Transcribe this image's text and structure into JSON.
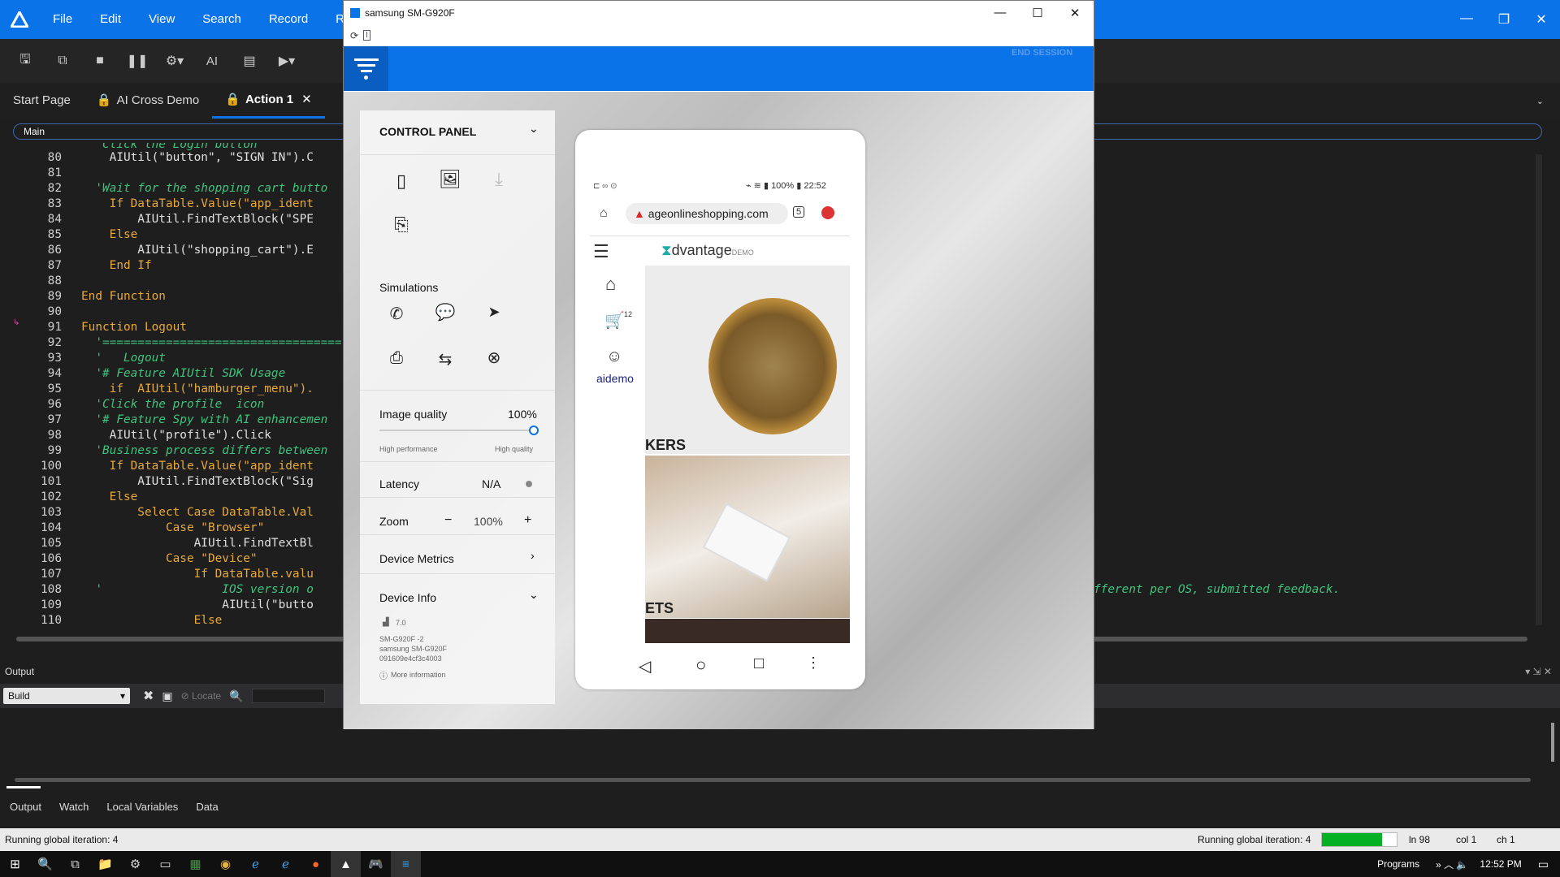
{
  "menu": {
    "items": [
      "File",
      "Edit",
      "View",
      "Search",
      "Record",
      "Ru"
    ]
  },
  "toolbar": {
    "ai_label": "AI"
  },
  "tabs": [
    {
      "label": "Start Page"
    },
    {
      "label": "AI Cross Demo"
    },
    {
      "label": "Action 1"
    }
  ],
  "main_select": "Main",
  "code": {
    "lines": [
      {
        "n": "80",
        "text": "    AIUtil(\"button\", \"SIGN IN\").C"
      },
      {
        "n": "81",
        "text": ""
      },
      {
        "n": "82",
        "text": "  'Wait for the shopping cart butto"
      },
      {
        "n": "83",
        "text": "    If DataTable.Value(\"app_ident"
      },
      {
        "n": "84",
        "text": "        AIUtil.FindTextBlock(\"SPE"
      },
      {
        "n": "85",
        "text": "    Else"
      },
      {
        "n": "86",
        "text": "        AIUtil(\"shopping_cart\").E"
      },
      {
        "n": "87",
        "text": "    End If"
      },
      {
        "n": "88",
        "text": ""
      },
      {
        "n": "89",
        "text": "End Function"
      },
      {
        "n": "90",
        "text": ""
      },
      {
        "n": "91",
        "text": "Function Logout"
      },
      {
        "n": "92",
        "text": "  '=================================="
      },
      {
        "n": "93",
        "text": "  '   Logout"
      },
      {
        "n": "94",
        "text": "  '# Feature AIUtil SDK Usage"
      },
      {
        "n": "95",
        "text": "    if  AIUtil(\"hamburger_menu\")."
      },
      {
        "n": "96",
        "text": "  'Click the profile  icon"
      },
      {
        "n": "97",
        "text": "  '# Feature Spy with AI enhancemen"
      },
      {
        "n": "98",
        "text": "    AIUtil(\"profile\").Click"
      },
      {
        "n": "99",
        "text": "  'Business process differs between"
      },
      {
        "n": "100",
        "text": "    If DataTable.Value(\"app_ident"
      },
      {
        "n": "101",
        "text": "        AIUtil.FindTextBlock(\"Sig"
      },
      {
        "n": "102",
        "text": "    Else"
      },
      {
        "n": "103",
        "text": "        Select Case DataTable.Val"
      },
      {
        "n": "104",
        "text": "            Case \"Browser\""
      },
      {
        "n": "105",
        "text": "                AIUtil.FindTextBl"
      },
      {
        "n": "106",
        "text": "            Case \"Device\""
      },
      {
        "n": "107",
        "text": "                If DataTable.valu"
      },
      {
        "n": "108",
        "text": "  '                 IOS version o"
      },
      {
        "n": "109",
        "text": "                    AIUtil(\"butto"
      },
      {
        "n": "110",
        "text": "                Else"
      }
    ],
    "partial_top": "  'Click the Login button",
    "right_comment": "fferent per OS, submitted feedback."
  },
  "output": {
    "title": "Output",
    "select": "Build",
    "locate": "Locate"
  },
  "bottom_tabs": [
    "Output",
    "Watch",
    "Local Variables",
    "Data"
  ],
  "status": {
    "left": "Running global iteration: 4",
    "right": "Running global iteration: 4",
    "progress": 0.8,
    "ln": "ln 98",
    "col": "col 1",
    "ch": "ch 1"
  },
  "taskbar": {
    "programs": "Programs",
    "time": "12:52 PM"
  },
  "device_window": {
    "title": "samsung SM-G920F",
    "end_session": "END SESSION",
    "control_panel": {
      "title": "CONTROL PANEL",
      "simulations": "Simulations",
      "image_quality_label": "Image quality",
      "image_quality_value": "100%",
      "image_quality_level": 1.0,
      "high_perf": "High performance",
      "high_quality": "High quality",
      "latency_label": "Latency",
      "latency_value": "N/A",
      "zoom_label": "Zoom",
      "zoom_value": "100%",
      "zoom_minus": "−",
      "zoom_plus": "+",
      "device_metrics": "Device Metrics",
      "device_info": "Device Info",
      "android_version": "7.0",
      "model": "SM-G920F -2",
      "name": "samsung SM-G920F",
      "serial": "091609e4cf3c4003",
      "more_info": "More information"
    },
    "phone": {
      "status_right": "100% ▮ 22:52",
      "url": "ageonlineshopping.com",
      "tab_count": "5",
      "brand": "dvantage",
      "brand_suffix": "DEMO",
      "cart_count": "12",
      "user": "aidemo",
      "cat1": "KERS",
      "cat2": "ETS"
    }
  }
}
